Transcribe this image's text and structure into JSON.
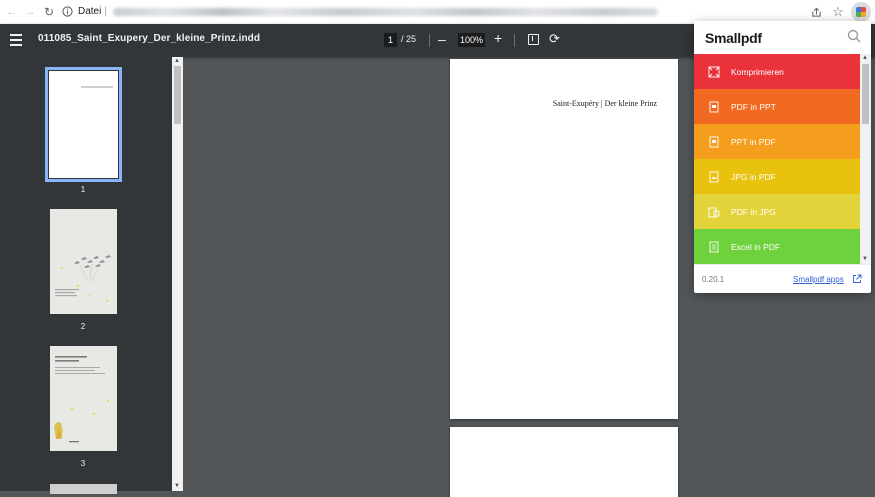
{
  "browser": {
    "back_icon": "arrow-left",
    "forward_icon": "arrow-right",
    "reload_icon": "reload",
    "address_prefix": "Datei",
    "address_separator": "|",
    "share_icon": "share",
    "star_icon": "star",
    "extension": "smallpdf-extension"
  },
  "toolbar": {
    "title": "011085_Saint_Exupery_Der_kleine_Prinz.indd",
    "page_current": "1",
    "page_total": "/ 25",
    "zoom_out": "–",
    "zoom": "100%",
    "zoom_in": "+"
  },
  "thumbnails": [
    {
      "label": "1",
      "selected": true
    },
    {
      "label": "2",
      "selected": false
    },
    {
      "label": "3",
      "selected": false
    }
  ],
  "page": {
    "header": "Saint-Exupéry | Der kleine Prinz"
  },
  "smallpdf": {
    "brand": "Smallpdf",
    "tools": [
      {
        "label": "Komprimieren",
        "color": "#e9323a",
        "icon": "compress-icon"
      },
      {
        "label": "PDF in PPT",
        "color": "#f26a21",
        "icon": "ppt-icon"
      },
      {
        "label": "PPT in PDF",
        "color": "#f59d1c",
        "icon": "ppt-icon"
      },
      {
        "label": "JPG in PDF",
        "color": "#e9c10f",
        "icon": "jpg-icon"
      },
      {
        "label": "PDF in JPG",
        "color": "#e3d33b",
        "icon": "jpg-icon"
      },
      {
        "label": "Excel in PDF",
        "color": "#6fd23c",
        "icon": "excel-icon"
      }
    ],
    "version": "0.20.1",
    "apps_link": "Smallpdf apps"
  }
}
